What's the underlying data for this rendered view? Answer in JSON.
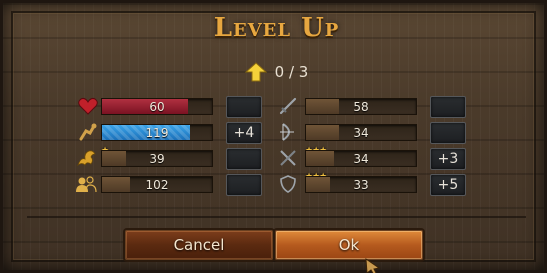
{
  "dialog": {
    "title": "Level Up",
    "points": "0 / 3"
  },
  "left_stats": [
    {
      "icon": "heart-icon",
      "value": "60",
      "fill": 0.78,
      "color": "red",
      "stars": "",
      "plus": ""
    },
    {
      "icon": "strength-arm-icon",
      "value": "119",
      "fill": 0.8,
      "color": "blue",
      "stars": "",
      "plus": "+4"
    },
    {
      "icon": "dragon-icon",
      "value": "39",
      "fill": 0.22,
      "color": "brown",
      "stars": "★",
      "plus": ""
    },
    {
      "icon": "group-icon",
      "value": "102",
      "fill": 0.25,
      "color": "brown",
      "stars": "",
      "plus": ""
    }
  ],
  "right_stats": [
    {
      "icon": "sword-icon",
      "value": "58",
      "fill": 0.3,
      "color": "brown",
      "stars": "",
      "plus": ""
    },
    {
      "icon": "bow-icon",
      "value": "34",
      "fill": 0.3,
      "color": "brown",
      "stars": "",
      "plus": ""
    },
    {
      "icon": "crossed-weapons-icon",
      "value": "34",
      "fill": 0.25,
      "color": "brown",
      "stars": "★★★",
      "plus": "+3"
    },
    {
      "icon": "shield-stars-icon",
      "value": "33",
      "fill": 0.22,
      "color": "brown",
      "stars": "★★★",
      "plus": "+5"
    }
  ],
  "buttons": {
    "cancel": "Cancel",
    "ok": "Ok"
  },
  "colors": {
    "title": "#e7a740",
    "health": "#b03040",
    "primary": "#2e8ed6",
    "star": "#f0c040"
  }
}
